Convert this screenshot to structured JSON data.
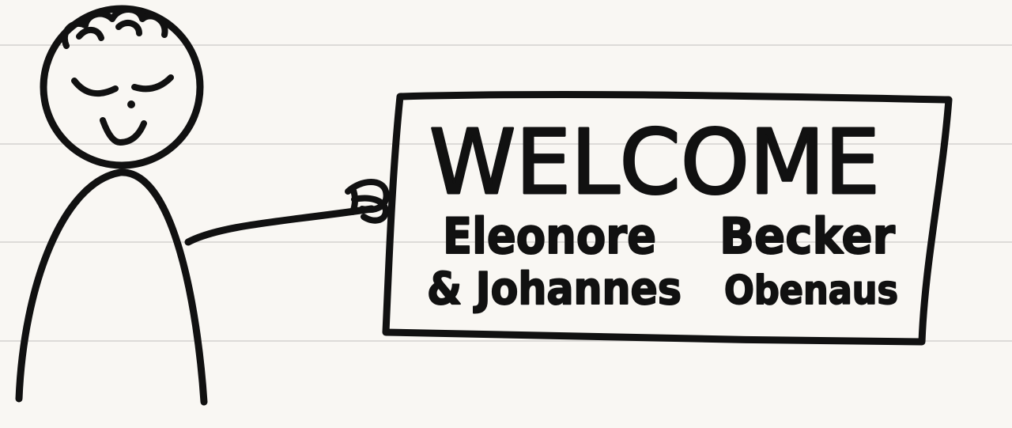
{
  "sign": {
    "heading": "WELCOME",
    "line1_left": "Eleonore",
    "line1_right": "Becker",
    "line2_left": "& Johannes",
    "line2_right": "Obenaus"
  },
  "colors": {
    "paper": "#f9f7f3",
    "ruled_line": "#dddbd8",
    "ink": "#111111"
  },
  "icons": [
    "stick-figure",
    "welcome-sign"
  ]
}
